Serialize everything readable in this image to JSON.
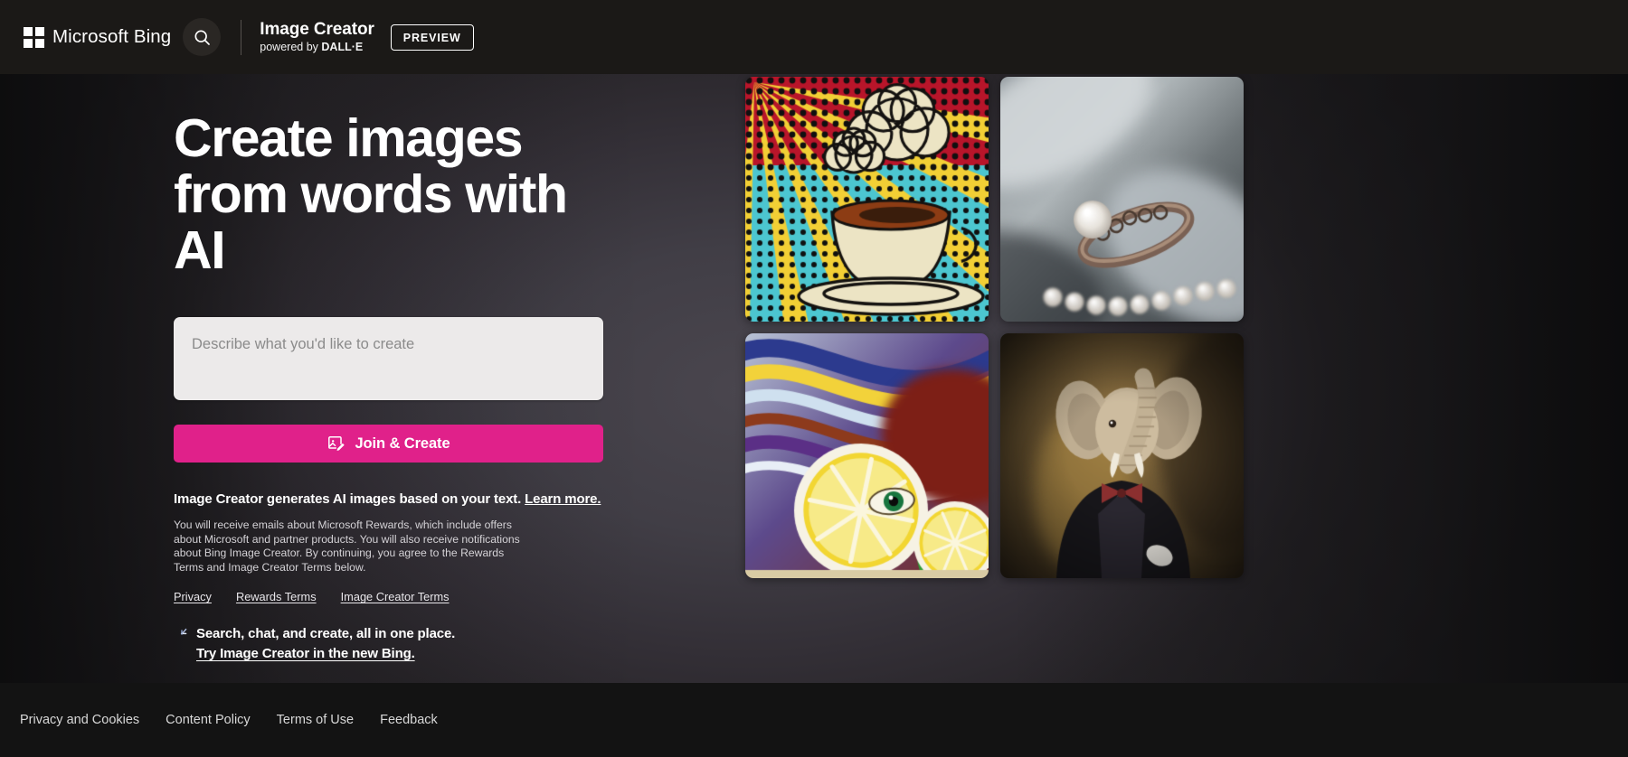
{
  "header": {
    "brand_name": "Microsoft Bing",
    "logo_icon": "microsoft-squares-icon",
    "search_icon": "search-icon",
    "product_title": "Image Creator",
    "product_subtitle_prefix": "powered by ",
    "product_subtitle_brand": "DALL·E",
    "preview_badge": "PREVIEW"
  },
  "hero": {
    "title": "Create images from words with AI",
    "prompt_placeholder": "Describe what you'd like to create",
    "prompt_value": "",
    "cta_label": "Join & Create",
    "cta_icon": "image-edit-icon",
    "cta_color": "#e0218a"
  },
  "legal": {
    "headline": "Image Creator generates AI images based on your text.",
    "headline_link": "Learn more.",
    "body": "You will receive emails about Microsoft Rewards, which include offers about Microsoft and partner products. You will also receive notifications about Bing Image Creator. By continuing, you agree to the Rewards Terms and Image Creator Terms below.",
    "links": [
      {
        "label": "Privacy"
      },
      {
        "label": "Rewards Terms"
      },
      {
        "label": "Image Creator Terms"
      }
    ]
  },
  "promo": {
    "icon": "bing-sparkle-icon",
    "line1": "Search, chat, and create, all in one place.",
    "line2": "Try Image Creator in the new Bing."
  },
  "gallery": {
    "tiles": [
      {
        "name": "pop-art-coffee-cup",
        "alt": "Pop art comic style coffee cup with steam on halftone dots"
      },
      {
        "name": "pearl-ring-macro",
        "alt": "Macro photo of an ornate silver ring with pearls on soft fabric"
      },
      {
        "name": "surreal-lemon-painting",
        "alt": "Surreal oil painting of lemon slices with an eye and swirling colors"
      },
      {
        "name": "elephant-in-suit-portrait",
        "alt": "Classical portrait painting of an elephant wearing a suit and bow tie"
      }
    ]
  },
  "footer": {
    "links": [
      {
        "label": "Privacy and Cookies"
      },
      {
        "label": "Content Policy"
      },
      {
        "label": "Terms of Use"
      },
      {
        "label": "Feedback"
      }
    ]
  }
}
